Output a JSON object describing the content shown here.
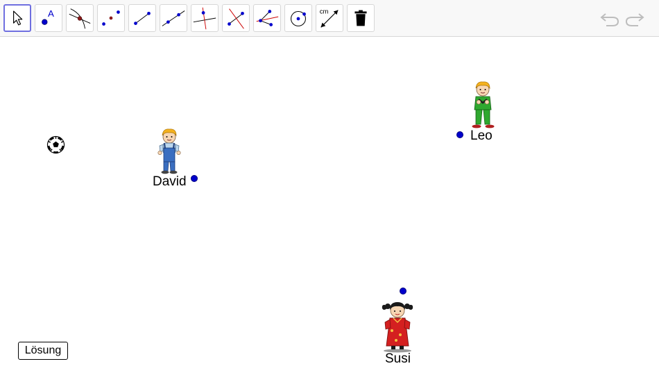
{
  "toolbar": {
    "tools": [
      {
        "name": "move-tool",
        "icon": "arrow-pointer-icon"
      },
      {
        "name": "point-tool",
        "icon": "point-with-label-icon",
        "label": "A"
      },
      {
        "name": "intersect-tool",
        "icon": "intersect-icon"
      },
      {
        "name": "midpoint-tool",
        "icon": "midpoint-icon"
      },
      {
        "name": "segment-tool",
        "icon": "segment-icon"
      },
      {
        "name": "line-tool",
        "icon": "line-icon"
      },
      {
        "name": "perpendicular-tool",
        "icon": "perpendicular-line-icon"
      },
      {
        "name": "perpendicular-bisector-tool",
        "icon": "perpendicular-bisector-icon"
      },
      {
        "name": "angle-bisector-tool",
        "icon": "angle-bisector-icon"
      },
      {
        "name": "circle-tool",
        "icon": "circle-center-point-icon"
      },
      {
        "name": "distance-tool",
        "icon": "distance-icon",
        "label": "cm"
      },
      {
        "name": "delete-tool",
        "icon": "trash-icon"
      }
    ],
    "undo_icon": "undo-icon",
    "redo_icon": "redo-icon"
  },
  "canvas": {
    "persons": [
      {
        "name": "David",
        "label": "David"
      },
      {
        "name": "Leo",
        "label": "Leo"
      },
      {
        "name": "Susi",
        "label": "Susi"
      }
    ],
    "ball_icon": "soccer-ball-icon",
    "solution_button": "Lösung"
  },
  "colors": {
    "point": "#0000cc",
    "selected_tool_border": "#6f6fe0",
    "line_red": "#cc0000"
  }
}
